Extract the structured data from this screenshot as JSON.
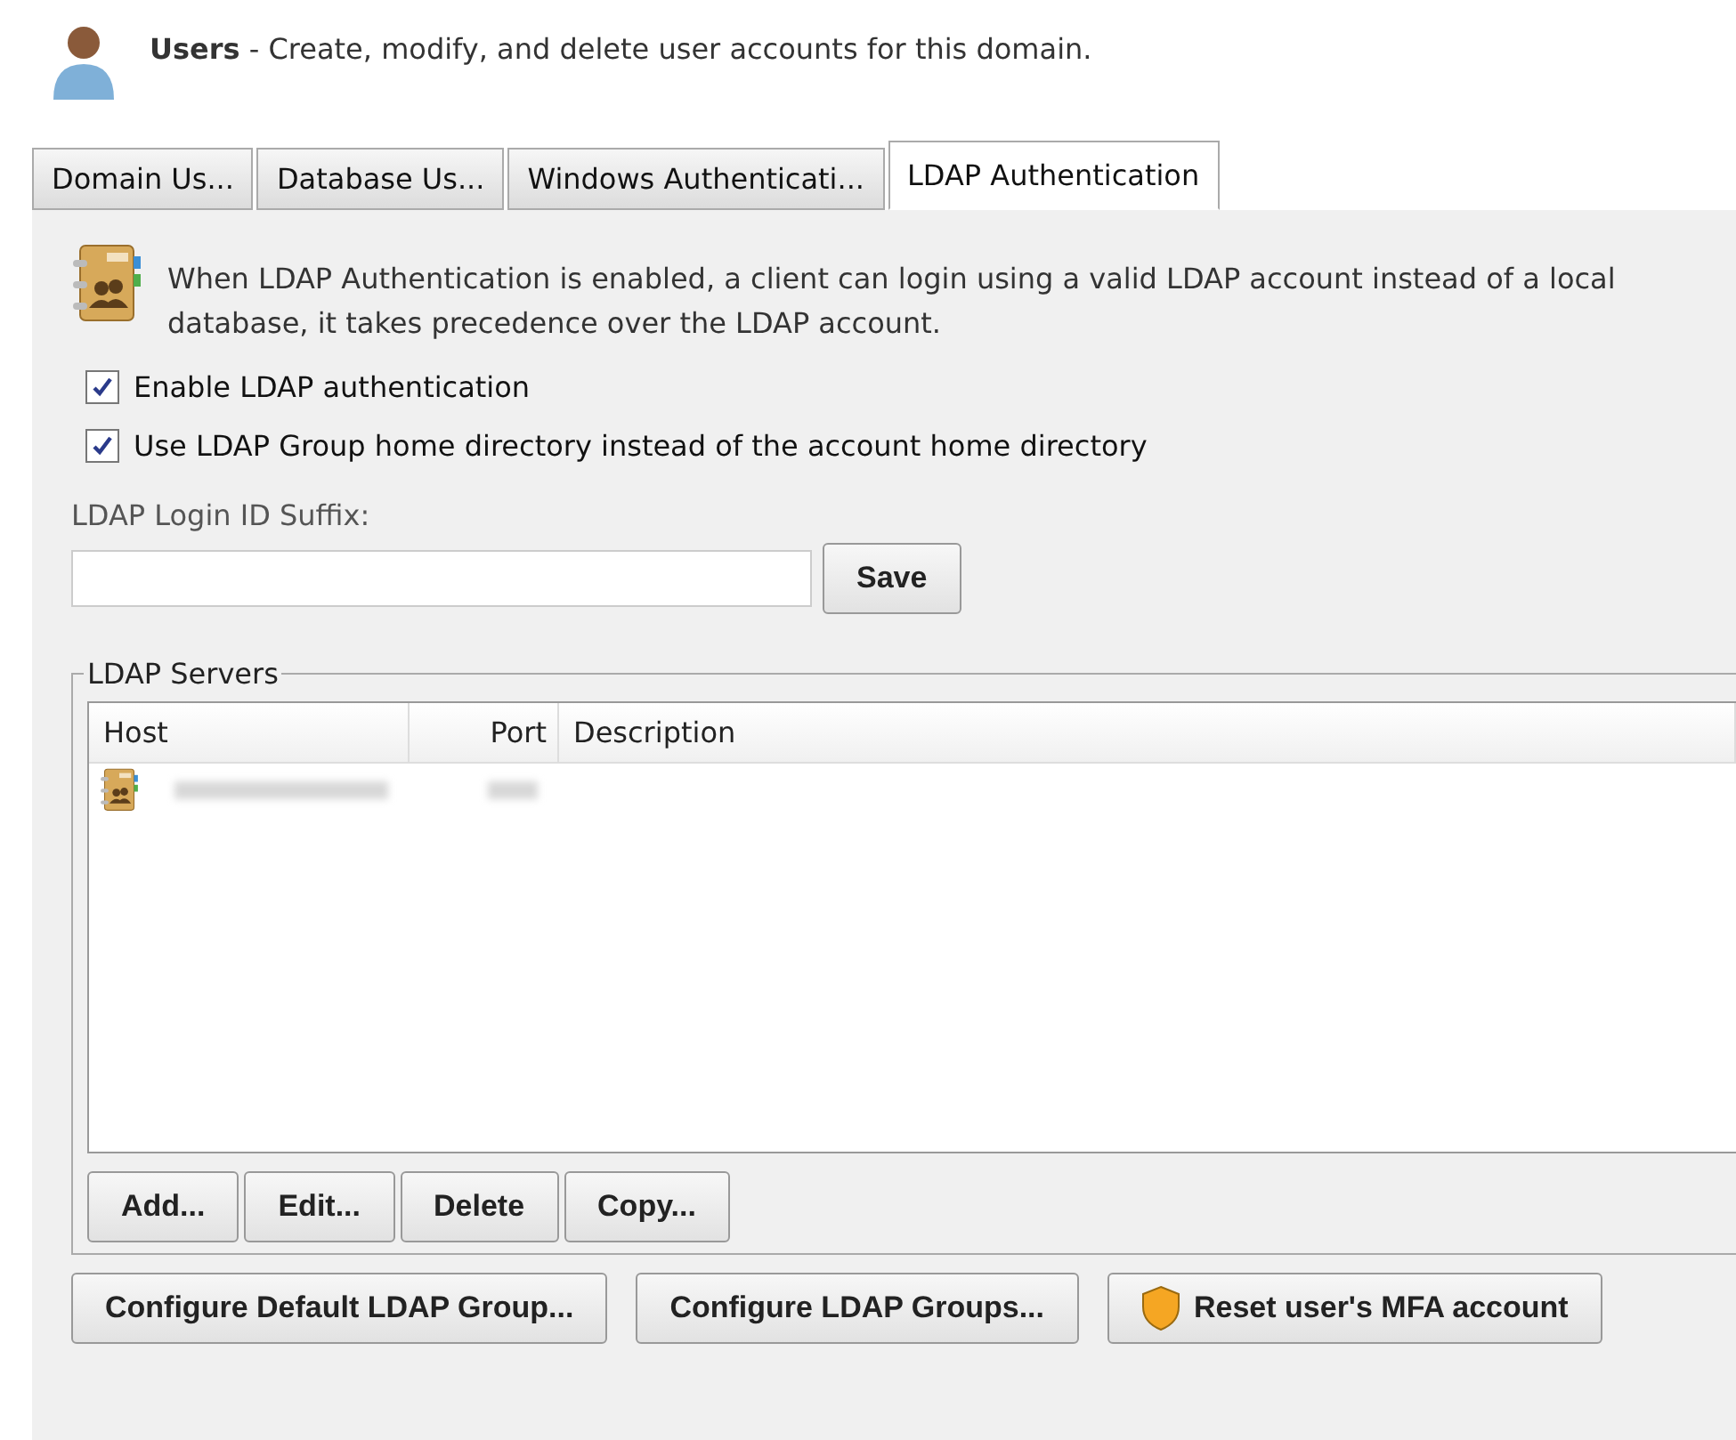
{
  "header": {
    "title": "Users",
    "description": " - Create, modify, and delete user accounts for this domain."
  },
  "tabs": [
    {
      "label": "Domain Us...",
      "selected": false
    },
    {
      "label": "Database Us...",
      "selected": false
    },
    {
      "label": "Windows Authenticati...",
      "selected": false
    },
    {
      "label": "LDAP Authentication",
      "selected": true
    }
  ],
  "info": {
    "lines": [
      "When LDAP Authentication is enabled, a client can login using a valid LDAP account instead of a local",
      "database, it takes precedence over the LDAP account."
    ]
  },
  "options": [
    {
      "label": "Enable LDAP authentication",
      "checked": true
    },
    {
      "label": "Use LDAP Group home directory instead of the account home directory",
      "checked": true
    }
  ],
  "suffix_field": {
    "label": "LDAP Login ID Suffix:",
    "button": "Save"
  },
  "servers": {
    "title": "LDAP Servers",
    "columns": [
      "Host",
      "Port",
      "Description"
    ],
    "rows": [
      {
        "selected": false
      }
    ],
    "buttons": [
      "Add...",
      "Edit...",
      "Delete",
      "Copy..."
    ]
  },
  "bottom_buttons": [
    {
      "label": "Configure Default LDAP Group...",
      "kind": "plain"
    },
    {
      "label": "Configure LDAP Groups...",
      "kind": "plain"
    },
    {
      "label": "Reset user's MFA account",
      "kind": "shield"
    }
  ]
}
